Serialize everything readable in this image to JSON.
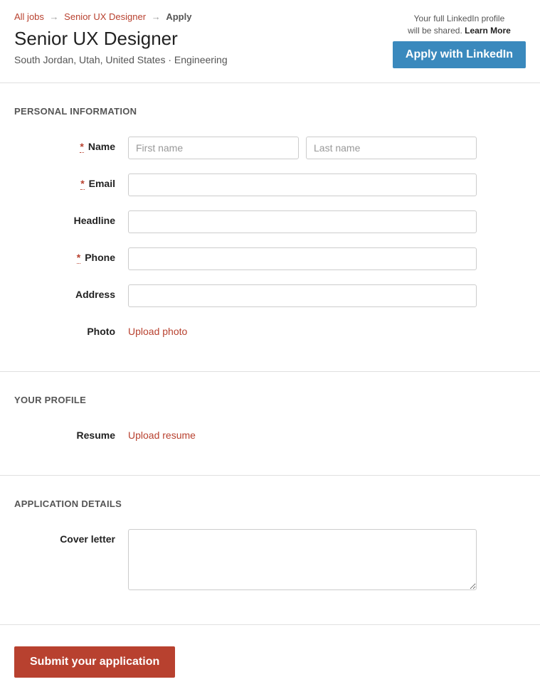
{
  "breadcrumbs": {
    "all_jobs": "All jobs",
    "job_link": "Senior UX Designer",
    "current": "Apply",
    "sep": "→"
  },
  "job": {
    "title": "Senior UX Designer",
    "location": "South Jordan, Utah, United States · Engineering"
  },
  "linkedin": {
    "note_line1": "Your full LinkedIn profile",
    "note_line2": "will be shared. ",
    "learn_more": "Learn More",
    "button": "Apply with LinkedIn"
  },
  "sections": {
    "personal": {
      "title": "PERSONAL INFORMATION",
      "name_label": "Name",
      "first_name_placeholder": "First name",
      "last_name_placeholder": "Last name",
      "email_label": "Email",
      "headline_label": "Headline",
      "phone_label": "Phone",
      "address_label": "Address",
      "photo_label": "Photo",
      "upload_photo": "Upload photo",
      "required": "*"
    },
    "profile": {
      "title": "YOUR PROFILE",
      "resume_label": "Resume",
      "upload_resume": "Upload resume"
    },
    "details": {
      "title": "APPLICATION DETAILS",
      "cover_letter_label": "Cover letter"
    }
  },
  "submit": {
    "button": "Submit your application"
  }
}
